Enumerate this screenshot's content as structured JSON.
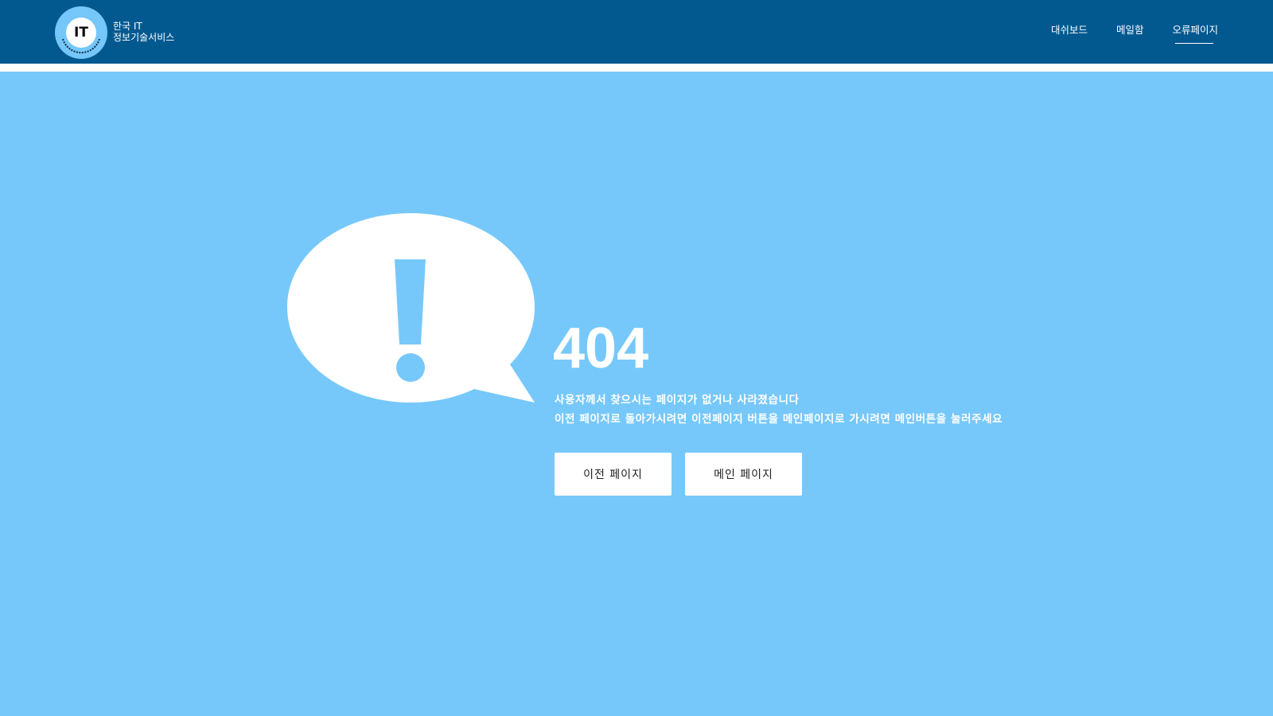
{
  "header": {
    "logo_text": "IT",
    "brand_line1": "한국 IT",
    "brand_line2": "정보기술서비스",
    "nav": [
      {
        "label": "대쉬보드",
        "active": false
      },
      {
        "label": "메일함",
        "active": false
      },
      {
        "label": "오류페이지",
        "active": true
      }
    ]
  },
  "error": {
    "code": "404",
    "message_line1": "사용자께서 찾으시는 페이지가 없거나 사라졌습니다",
    "message_line2": "이전 페이지로 돌아가시려면 이전페이지 버튼을 메인페이지로 가시려면 메인버튼을 눌러주세요",
    "icon": "exclamation-speech-bubble-icon"
  },
  "buttons": {
    "prev_label": "이전 페이지",
    "main_label": "메인 페이지"
  },
  "colors": {
    "header_bg": "#025990",
    "main_bg": "#77c8fa",
    "logo_bg": "#75c7fa",
    "text": "#ffffff"
  }
}
